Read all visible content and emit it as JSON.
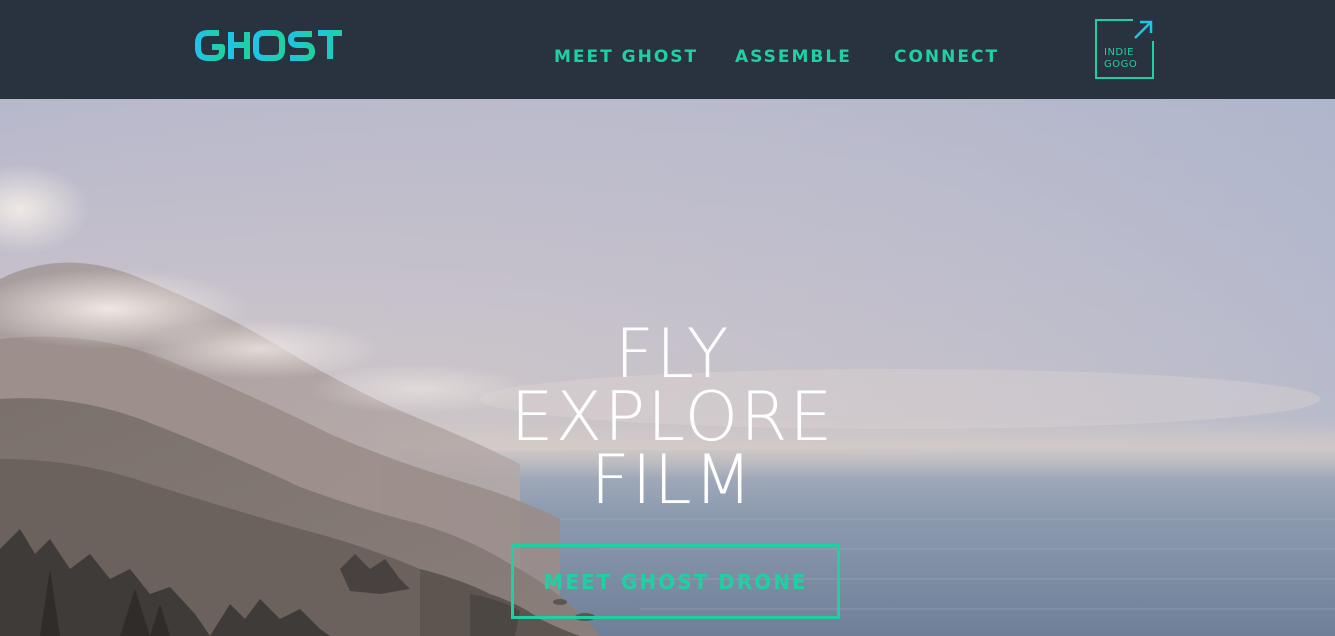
{
  "header": {
    "logo_text": "GHOST",
    "nav": [
      {
        "label": "MEET GHOST"
      },
      {
        "label": "ASSEMBLE"
      },
      {
        "label": "CONNECT"
      }
    ],
    "indiegogo": {
      "line1": "INDIE",
      "line2": "GOGO",
      "icon": "arrow-up-right-icon"
    }
  },
  "hero": {
    "headline": [
      "FLY",
      "EXPLORE",
      "FILM"
    ],
    "cta_label": "MEET GHOST DRONE"
  },
  "colors": {
    "nav_bg": "#28333f",
    "accent": "#1fd0a2",
    "logo_gradient_start": "#1fd0a2",
    "logo_gradient_end": "#1fc4e6"
  }
}
